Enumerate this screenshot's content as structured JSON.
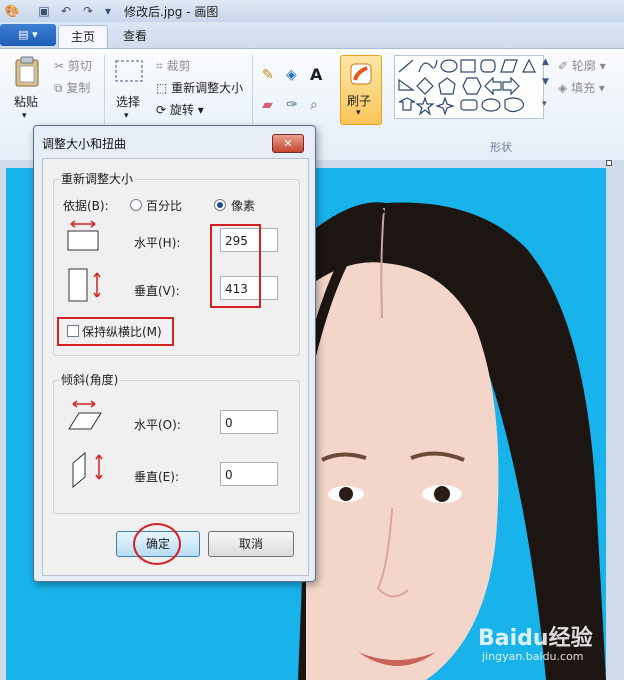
{
  "titlebar": {
    "title": "修改后.jpg - 画图"
  },
  "tabs": [
    {
      "label": "主页",
      "active": true
    },
    {
      "label": "查看",
      "active": false
    }
  ],
  "ribbon": {
    "clipboard": {
      "paste": "粘贴",
      "cut": "剪切",
      "copy": "复制"
    },
    "image": {
      "select": "选择",
      "crop": "裁剪",
      "resize": "重新调整大小",
      "rotate": "旋转"
    },
    "brushes": "刷子",
    "shapes_label": "形状",
    "outline": "轮廓",
    "fill": "填充"
  },
  "dialog": {
    "title": "调整大小和扭曲",
    "close_glyph": "✕",
    "resize_group": "重新调整大小",
    "by_label": "依据(B):",
    "percent": "百分比",
    "pixels": "像素",
    "selected_unit": "像素",
    "horizontal_label": "水平(H):",
    "horizontal_value": "295",
    "vertical_label": "垂直(V):",
    "vertical_value": "413",
    "keep_ratio_label": "保持纵横比(M)",
    "keep_ratio_checked": false,
    "skew_group": "倾斜(角度)",
    "skew_h_label": "水平(O):",
    "skew_h_value": "0",
    "skew_v_label": "垂直(E):",
    "skew_v_value": "0",
    "ok": "确定",
    "cancel": "取消"
  },
  "watermark": {
    "logo": "Baidu经验",
    "url": "jingyan.baidu.com"
  },
  "colors": {
    "canvas_bg": "#19b3ec",
    "annotation": "#d42222"
  }
}
